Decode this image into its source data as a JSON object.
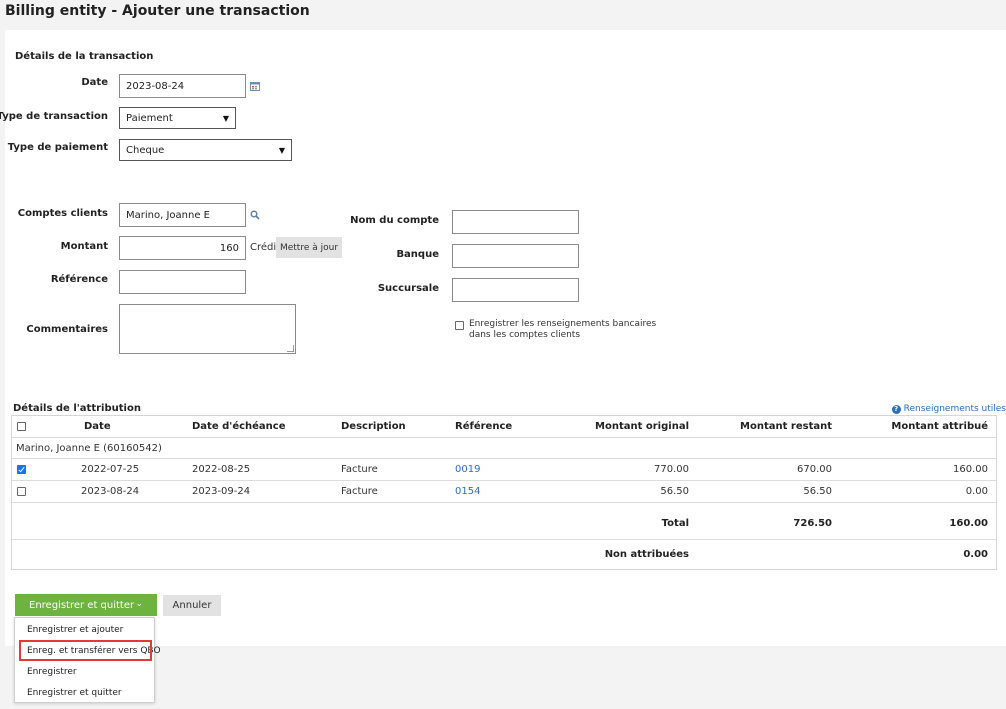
{
  "page": {
    "title": "Billing entity - Ajouter une transaction"
  },
  "transaction": {
    "section_title": "Détails de la transaction",
    "date_label": "Date",
    "date_value": "2023-08-24",
    "type_label": "Type de transaction",
    "type_value": "Paiement",
    "payment_type_label": "Type de paiement",
    "payment_type_value": "Cheque"
  },
  "client": {
    "accounts_label": "Comptes clients",
    "accounts_value": "Marino, Joanne E",
    "amount_label": "Montant",
    "amount_value": "160",
    "credit_label": "Crédit",
    "update_button": "Mettre à jour",
    "reference_label": "Référence",
    "reference_value": "",
    "comments_label": "Commentaires"
  },
  "bank": {
    "account_name_label": "Nom du compte",
    "bank_label": "Banque",
    "branch_label": "Succursale",
    "save_info_line1": "Enregistrer les renseignements bancaires",
    "save_info_line2": "dans les comptes clients"
  },
  "attribution": {
    "section_title": "Détails de l'attribution",
    "help_link": "Renseignements utiles",
    "headers": {
      "date": "Date",
      "due_date": "Date d'échéance",
      "description": "Description",
      "reference": "Référence",
      "original": "Montant original",
      "remaining": "Montant restant",
      "attributed": "Montant attribué"
    },
    "group_label": "Marino, Joanne E  (60160542)",
    "rows": [
      {
        "checked": true,
        "date": "2022-07-25",
        "due": "2022-08-25",
        "desc": "Facture",
        "ref": "0019",
        "original": "770.00",
        "remaining": "670.00",
        "attributed": "160.00"
      },
      {
        "checked": false,
        "date": "2023-08-24",
        "due": "2023-09-24",
        "desc": "Facture",
        "ref": "0154",
        "original": "56.50",
        "remaining": "56.50",
        "attributed": "0.00"
      }
    ],
    "total_label": "Total",
    "total_remaining": "726.50",
    "total_attributed": "160.00",
    "unattributed_label": "Non attribuées",
    "unattributed_value": "0.00"
  },
  "actions": {
    "primary": "Enregistrer et quitter",
    "cancel": "Annuler",
    "menu": [
      "Enregistrer et ajouter",
      "Enreg. et transférer vers QBO",
      "Enregistrer",
      "Enregistrer et quitter"
    ]
  },
  "colors": {
    "primary_green": "#6db33f",
    "link_blue": "#2a6fb7",
    "highlight_red": "#e53935",
    "checkbox_blue": "#1a73e8"
  }
}
